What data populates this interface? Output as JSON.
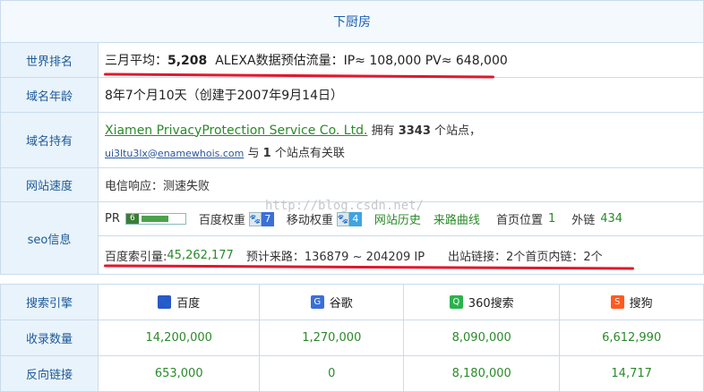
{
  "header": {
    "title": "下厨房"
  },
  "rows": {
    "rank": {
      "label": "世界排名",
      "prefix": "三月平均：",
      "value": "5,208",
      "alexa": "ALEXA数据预估流量：IP≈ 108,000 PV≈ 648,000"
    },
    "age": {
      "label": "域名年龄",
      "value": "8年7个月10天（创建于2007年9月14日）"
    },
    "owner": {
      "label": "域名持有",
      "company": "Xiamen PrivacyProtection Service Co. Ltd.",
      "owns_prefix": "拥有",
      "owns_count": "3343",
      "owns_suffix": "个站点，",
      "email": "ui3ltu3lx@enamewhois.com",
      "related_prefix": "与",
      "related_count": "1",
      "related_suffix": "个站点有关联"
    },
    "speed": {
      "label": "网站速度",
      "value": "电信响应：测速失败"
    },
    "seo": {
      "label": "seo信息",
      "pr_label": "PR",
      "pr_value": "6",
      "pr_fraction": 0.6,
      "baidu_weight_label": "百度权重",
      "baidu_weight": "7",
      "mobile_weight_label": "移动权重",
      "mobile_weight": "4",
      "history_link": "网站历史",
      "curve_link": "来路曲线",
      "home_pos_label": "首页位置",
      "home_pos": "1",
      "outlink_label": "外链",
      "outlink": "434",
      "index_label": "百度索引量:",
      "index_value": "45,262,177",
      "expected_label": "预计来路：136879 ~ 204209 IP",
      "out_links": "出站链接：2个首页内链：2个"
    }
  },
  "engines": {
    "col_header": "搜索引擎",
    "names": [
      "百度",
      "谷歌",
      "360搜索",
      "搜狗"
    ],
    "icons": [
      "baidu-paw-icon",
      "google-g-icon",
      "360-search-icon",
      "sogou-s-icon"
    ],
    "icon_colors": [
      "#2b57c9",
      "#3a6fd8",
      "#2bb24c",
      "#ff5a1f"
    ],
    "indexed_label": "收录数量",
    "indexed": [
      "14,200,000",
      "1,270,000",
      "8,090,000",
      "6,612,990"
    ],
    "backlinks_label": "反向链接",
    "backlinks": [
      "653,000",
      "0",
      "8,180,000",
      "14,717"
    ]
  },
  "watermark": "http://blog.csdn.net/",
  "colors": {
    "accent_red": "#e0182d",
    "green": "#2a8a2a",
    "label_bg": "#e9f3fb",
    "label_text": "#1d5a9a"
  }
}
